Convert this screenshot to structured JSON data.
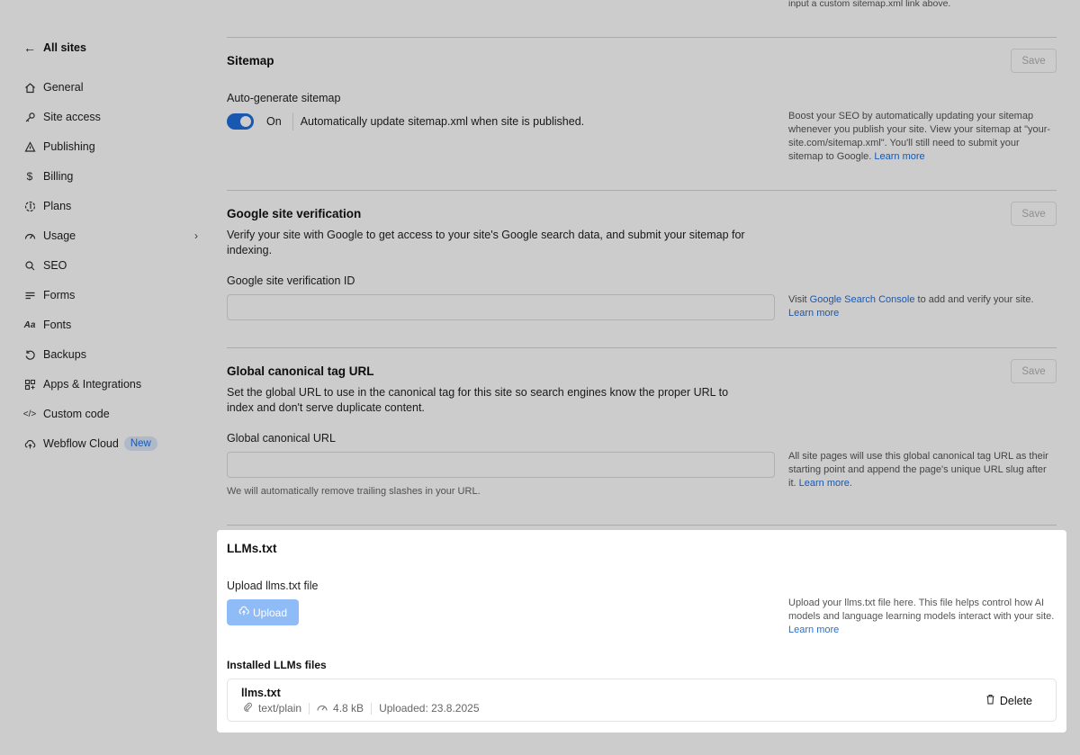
{
  "top_note": "input a custom sitemap.xml link above.",
  "sidebar": {
    "back_label": "All sites",
    "items": [
      {
        "label": "General",
        "icon": "home-icon"
      },
      {
        "label": "Site access",
        "icon": "key-icon"
      },
      {
        "label": "Publishing",
        "icon": "publish-icon"
      },
      {
        "label": "Billing",
        "icon": "dollar-icon"
      },
      {
        "label": "Plans",
        "icon": "plans-icon"
      },
      {
        "label": "Usage",
        "icon": "gauge-icon"
      },
      {
        "label": "SEO",
        "icon": "search-icon"
      },
      {
        "label": "Forms",
        "icon": "forms-icon"
      },
      {
        "label": "Fonts",
        "icon": "fonts-icon"
      },
      {
        "label": "Backups",
        "icon": "backup-icon"
      },
      {
        "label": "Apps & Integrations",
        "icon": "apps-icon"
      },
      {
        "label": "Custom code",
        "icon": "code-icon"
      },
      {
        "label": "Webflow Cloud",
        "icon": "cloud-icon",
        "badge": "New"
      }
    ]
  },
  "sitemap": {
    "title": "Sitemap",
    "save_label": "Save",
    "field_label": "Auto-generate sitemap",
    "toggle_state": "On",
    "toggle_desc": "Automatically update sitemap.xml when site is published.",
    "help": "Boost your SEO by automatically updating your sitemap whenever you publish your site. View your sitemap at \"your-site.com/sitemap.xml\". You'll still need to submit your sitemap to Google.",
    "help_link": "Learn more"
  },
  "google": {
    "title": "Google site verification",
    "save_label": "Save",
    "desc": "Verify your site with Google to get access to your site's Google search data, and submit your sitemap for indexing.",
    "field_label": "Google site verification ID",
    "input_value": "",
    "help_prefix": "Visit",
    "help_link1": "Google Search Console",
    "help_mid": "to add and verify your site.",
    "help_link2": "Learn more"
  },
  "canonical": {
    "title": "Global canonical tag URL",
    "save_label": "Save",
    "desc": "Set the global URL to use in the canonical tag for this site so search engines know the proper URL to index and don't serve duplicate content.",
    "field_label": "Global canonical URL",
    "input_value": "",
    "hint": "We will automatically remove trailing slashes in your URL.",
    "help": "All site pages will use this global canonical tag URL as their starting point and append the page's unique URL slug after it.",
    "help_link": "Learn more."
  },
  "llms": {
    "title": "LLMs.txt",
    "field_label": "Upload llms.txt file",
    "upload_label": "Upload",
    "help": "Upload your llms.txt file here. This file helps control how AI models and language learning models interact with your site.",
    "help_link": "Learn more",
    "installed_title": "Installed LLMs files",
    "file": {
      "name": "llms.txt",
      "type": "text/plain",
      "size": "4.8 kB",
      "uploaded": "Uploaded: 23.8.2025",
      "delete_label": "Delete"
    }
  },
  "colors": {
    "accent": "#1f6fde",
    "upload_disabled": "#8fbcf6"
  }
}
